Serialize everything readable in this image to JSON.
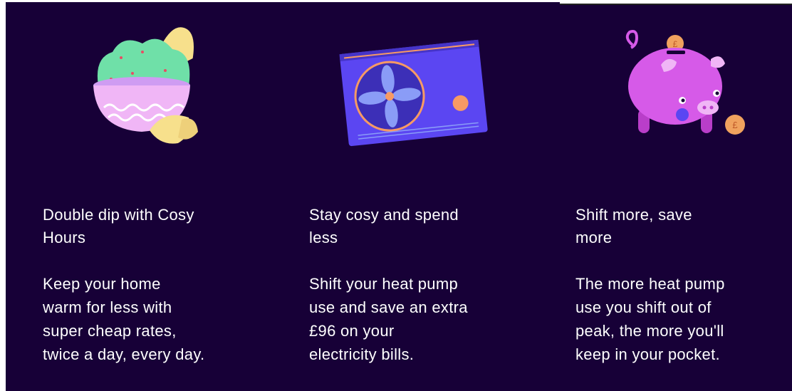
{
  "features": [
    {
      "title": "Double dip with Cosy\nHours",
      "body": "Keep your home\nwarm for less with\nsuper cheap rates,\ntwice a day, every day.",
      "icon": "guacamole-bowl-icon"
    },
    {
      "title": "Stay cosy and spend\nless",
      "body": "Shift your heat pump\nuse and save an extra\n£96 on your\nelectricity bills.",
      "icon": "heat-pump-icon"
    },
    {
      "title": "Shift more, save\nmore",
      "body": "The more heat pump\nuse you shift out of\npeak, the more you'll\nkeep in your pocket.",
      "icon": "piggy-bank-icon"
    }
  ],
  "colors": {
    "background": "#170037",
    "text": "#ffffff",
    "dip_green": "#6fe0a8",
    "bowl_pink": "#f0b6f6",
    "chip_yellow": "#f7e08c",
    "pump_purple": "#5b46f2",
    "pump_orange": "#f79a64",
    "piggy_magenta": "#d65ae8",
    "coin_orange": "#f0a25e"
  }
}
